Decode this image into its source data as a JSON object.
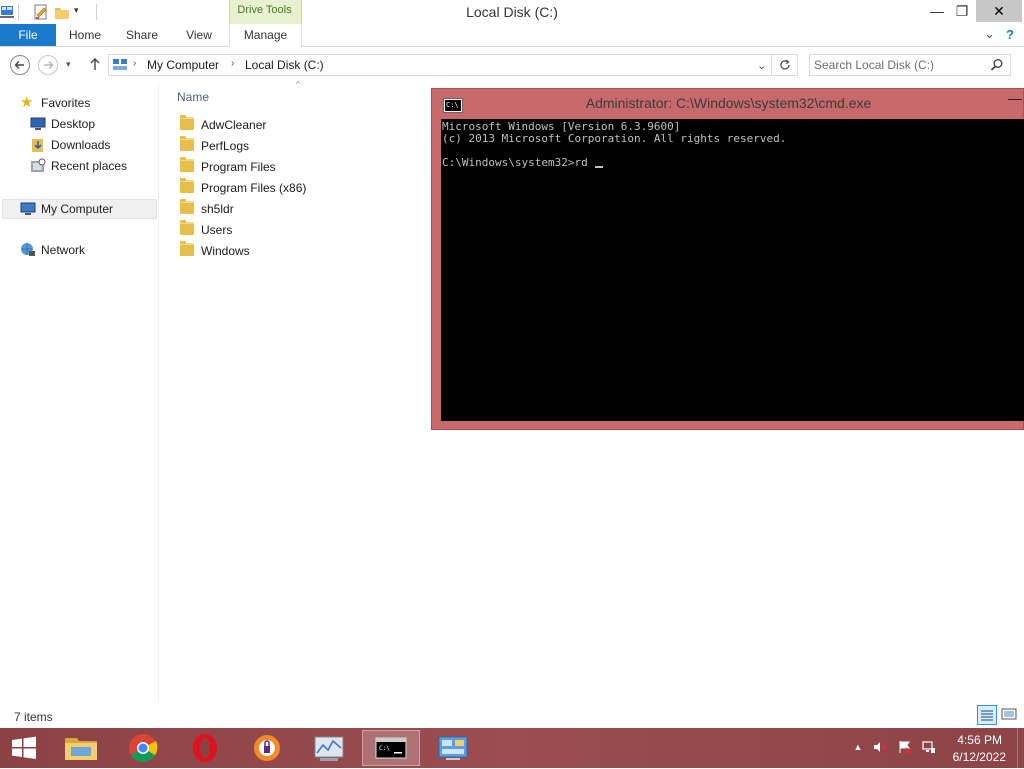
{
  "window": {
    "title": "Local Disk (C:)",
    "context_tab_group": "Drive Tools",
    "buttons": {
      "minimize": "—",
      "restore": "❐",
      "close": "✕"
    }
  },
  "ribbon": {
    "tabs": [
      "File",
      "Home",
      "Share",
      "View",
      "Manage"
    ],
    "expand_glyph": "⌄",
    "help_glyph": "?"
  },
  "address": {
    "breadcrumb": [
      "My Computer",
      "Local Disk (C:)"
    ],
    "separator": "›"
  },
  "search": {
    "placeholder": "Search Local Disk (C:)"
  },
  "nav_pane": {
    "favorites_label": "Favorites",
    "favorites": [
      "Desktop",
      "Downloads",
      "Recent places"
    ],
    "my_computer": "My Computer",
    "network": "Network"
  },
  "content": {
    "column_header": "Name",
    "folders": [
      "AdwCleaner",
      "PerfLogs",
      "Program Files",
      "Program Files (x86)",
      "sh5ldr",
      "Users",
      "Windows"
    ]
  },
  "status": {
    "items": "7 items"
  },
  "cmd": {
    "title": "Administrator: C:\\Windows\\system32\\cmd.exe",
    "lines": [
      "Microsoft Windows [Version 6.3.9600]",
      "(c) 2013 Microsoft Corporation. All rights reserved.",
      "",
      "C:\\Windows\\system32>rd "
    ]
  },
  "taskbar": {
    "apps": [
      "start-button",
      "file-explorer",
      "chrome",
      "opera",
      "avast-browser",
      "performance-monitor",
      "command-prompt",
      "control-panel"
    ],
    "active_app": "command-prompt",
    "clock": {
      "time": "4:56 PM",
      "date": "6/12/2022"
    }
  },
  "colors": {
    "file_tab": "#1979ca",
    "drive_tools_band": "#e7f1cf",
    "cmd_frame": "#c86a6c",
    "taskbar": "#8c4244",
    "console_bg": "#000000",
    "console_fg": "#c0c0c0"
  }
}
